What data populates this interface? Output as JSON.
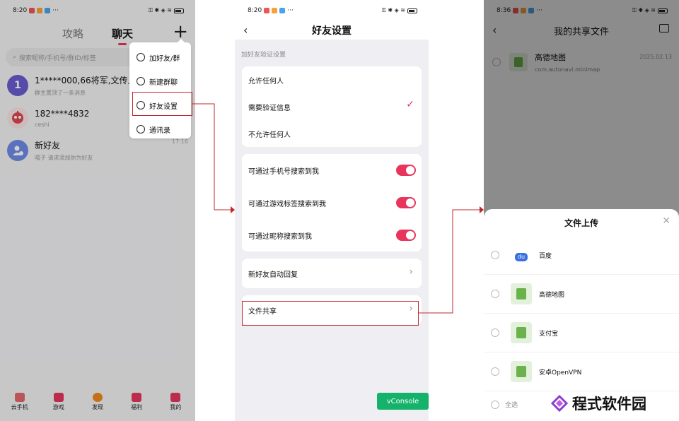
{
  "panel1": {
    "status_time": "8:20",
    "status_more": "···",
    "tabs": [
      "攻略",
      "聊天"
    ],
    "active_tab": "聊天",
    "search_placeholder": "搜索昵称/手机号/群ID/标签",
    "chats": [
      {
        "avatar_text": "1",
        "name": "1*****000,66将军,文传上",
        "sub": "群主置顶了一条消息",
        "time": "",
        "avatar_color": "#6a5ccf"
      },
      {
        "avatar_text": "",
        "name": "182****4832",
        "sub": "ceshi",
        "time": "",
        "avatar_color": "#d9474f"
      },
      {
        "avatar_text": "",
        "name": "新好友",
        "sub": "嘻子 请求添加你为好友",
        "time": "17:16",
        "avatar_color": "#6e8ae6"
      }
    ],
    "menu": [
      "加好友/群",
      "新建群聊",
      "好友设置",
      "通讯录"
    ],
    "nav": [
      "云手机",
      "游戏",
      "发现",
      "福利",
      "我的"
    ]
  },
  "panel2": {
    "status_time": "8:20",
    "status_more": "···",
    "title": "好友设置",
    "section_label": "加好友验证设置",
    "verify_options": [
      "允许任何人",
      "需要验证信息",
      "不允许任何人"
    ],
    "verify_selected_index": 1,
    "search_toggles": [
      {
        "label": "可通过手机号搜索到我",
        "on": true
      },
      {
        "label": "可通过游戏标签搜索到我",
        "on": true
      },
      {
        "label": "可通过昵称搜索到我",
        "on": true
      }
    ],
    "auto_reply": "新好友自动回复",
    "file_share": "文件共享",
    "vconsole": "vConsole"
  },
  "panel3": {
    "status_time": "8:36",
    "status_more": "···",
    "title": "我的共享文件",
    "file": {
      "name": "高德地图",
      "package": "com.autonavi.minimap",
      "date": "2025.02.13"
    },
    "sheet_title": "文件上传",
    "upload_items": [
      {
        "name": "百度",
        "icon": "baidu-icon"
      },
      {
        "name": "高德地图",
        "icon": "apk-icon"
      },
      {
        "name": "支付宝",
        "icon": "apk-icon"
      },
      {
        "name": "安卓OpenVPN",
        "icon": "apk-icon"
      }
    ],
    "select_all": "全选"
  },
  "watermark": "程式软件园",
  "colors": {
    "accent": "#e5365f",
    "highlight_border": "#c0282c",
    "vconsole": "#14b26a",
    "apk_green": "#6ab34c"
  }
}
